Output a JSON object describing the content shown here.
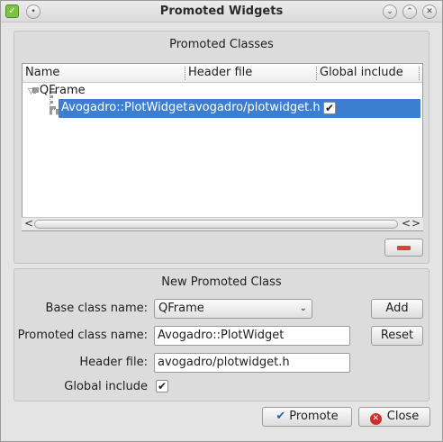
{
  "window": {
    "title": "Promoted Widgets"
  },
  "promoted_classes": {
    "title": "Promoted Classes",
    "columns": [
      "Name",
      "Header file",
      "Global include"
    ],
    "tree": {
      "parent": "QFrame",
      "child": {
        "name": "Avogadro::PlotWidget",
        "header_file": "avogadro/plotwidget.h",
        "global_include": true
      }
    },
    "scroll_left": "<",
    "scroll_right": "<",
    "scroll_right2": ">"
  },
  "new_class": {
    "title": "New Promoted Class",
    "base_label": "Base class name:",
    "base_value": "QFrame",
    "promoted_label": "Promoted class name:",
    "promoted_value": "Avogadro::PlotWidget",
    "header_label": "Header file:",
    "header_value": "avogadro/plotwidget.h",
    "global_label": "Global include",
    "global_checked": true,
    "add_label": "Add",
    "reset_label": "Reset"
  },
  "buttons": {
    "promote": "Promote",
    "close": "Close"
  },
  "colors": {
    "selection": "#3c7fd0",
    "remove": "#e23c3c",
    "close_icon": "#d42a2a"
  }
}
